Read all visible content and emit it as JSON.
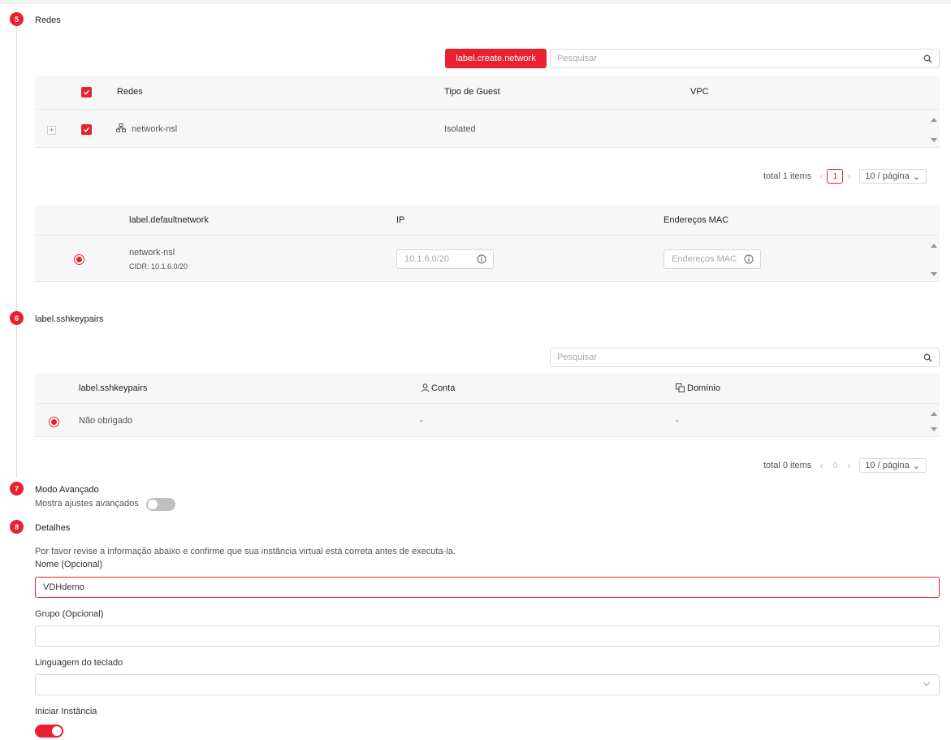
{
  "steps": [
    {
      "number": "5",
      "title": "Redes"
    },
    {
      "number": "6",
      "title": "label.sshkeypairs"
    },
    {
      "number": "7",
      "title": "Modo Avançado"
    },
    {
      "number": "8",
      "title": "Detalhes"
    }
  ],
  "networks": {
    "create_button": "label.create.network",
    "search_placeholder": "Pesquisar",
    "columns": [
      "Redes",
      "Tipo de Guest",
      "VPC"
    ],
    "rows": [
      {
        "name": "network-nsl",
        "guest_type": "Isolated",
        "vpc": ""
      }
    ],
    "pagination": {
      "total": "total 1 items",
      "page": "1",
      "page_size": "10 / página"
    }
  },
  "default_network": {
    "columns": [
      "label.defaultnetwork",
      "IP",
      "Endereços MAC"
    ],
    "rows": [
      {
        "name": "network-nsl",
        "cidr": "CIDR: 10.1.6.0/20",
        "ip_placeholder": "10.1.6.0/20",
        "mac_placeholder": "Endereços MAC"
      }
    ]
  },
  "sshkeypairs": {
    "search_placeholder": "Pesquisar",
    "columns": [
      "label.sshkeypairs",
      "Conta",
      "Domínio"
    ],
    "rows": [
      {
        "name": "Não obrigado",
        "account": "-",
        "domain": "-"
      }
    ],
    "pagination": {
      "total": "total 0 items",
      "page": "0",
      "page_size": "10 / página"
    }
  },
  "advanced": {
    "toggle_label": "Mostra ajustes avançados",
    "enabled": false
  },
  "details": {
    "description": "Por favor revise a informação abaixo e confirme que sua instância virtual está correta antes de executa-la.",
    "name_label": "Nome (Opcional)",
    "name_value": "VDHdemo",
    "group_label": "Grupo (Opcional)",
    "group_value": "",
    "keyboard_label": "Linguagem do teclado",
    "keyboard_value": "",
    "start_label": "Iniciar Instância",
    "start_enabled": true
  },
  "colors": {
    "accent": "#e8202f",
    "header_bg": "#f7f7f7",
    "border": "#d9d9d9",
    "toggle_off": "#bfbfbf"
  }
}
